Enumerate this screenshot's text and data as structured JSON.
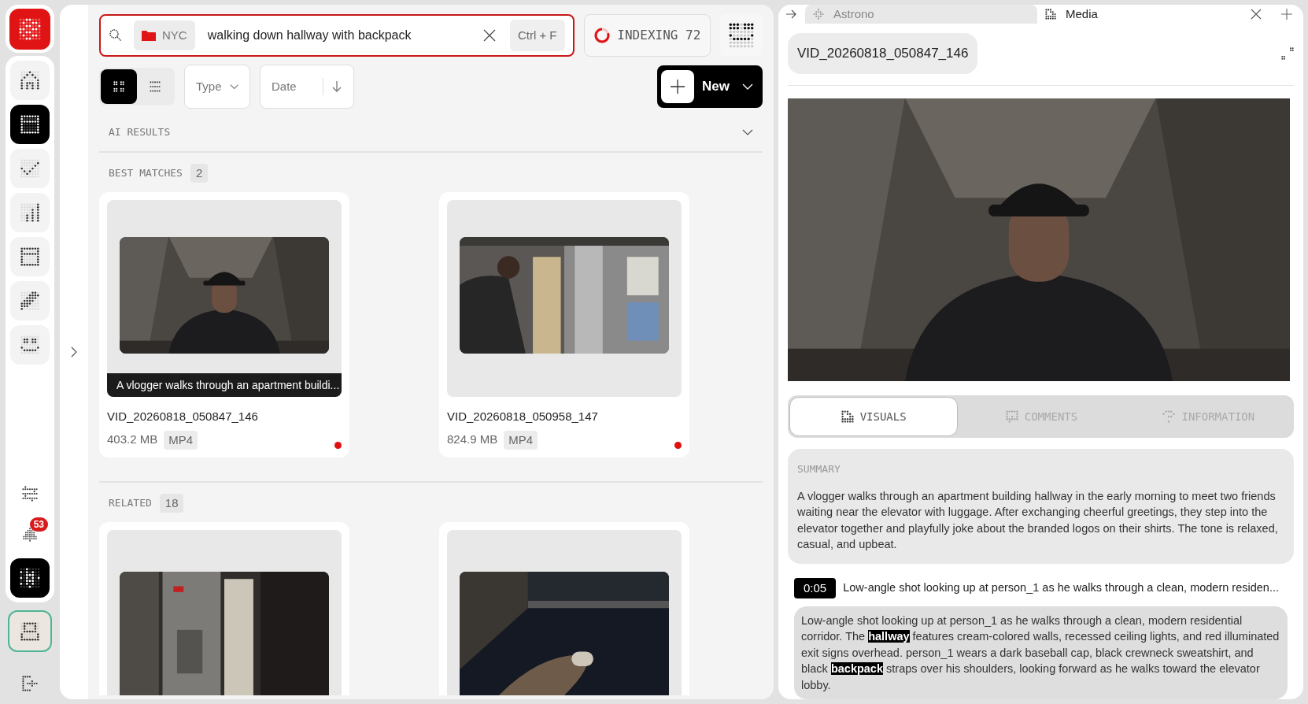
{
  "sidebar": {
    "items": [
      {
        "selected": false
      },
      {
        "selected": true
      },
      {
        "selected": false
      },
      {
        "selected": false
      },
      {
        "selected": false
      },
      {
        "selected": false
      },
      {
        "selected": false
      }
    ],
    "notifications": "53",
    "account": {
      "active": true
    }
  },
  "search": {
    "scope": "NYC",
    "value": "walking down hallway with backpack",
    "shortcut": "Ctrl + F"
  },
  "indexing": {
    "label": "INDEXING 72"
  },
  "view_toggle": [
    {
      "selected": true
    },
    {
      "selected": false
    }
  ],
  "filters": [
    {
      "label": "Type"
    },
    {
      "label": "Date"
    }
  ],
  "new_button": "New",
  "ai_results": {
    "label": "AI RESULTS"
  },
  "best_matches": {
    "label": "BEST MATCHES",
    "count": "2",
    "items": [
      {
        "caption": "A vlogger walks through an apartment buildi...",
        "filename": "VID_20260818_050847_146",
        "size": "403.2 MB",
        "format": "MP4"
      },
      {
        "filename": "VID_20260818_050958_147",
        "size": "824.9 MB",
        "format": "MP4"
      }
    ]
  },
  "related": {
    "label": "RELATED",
    "count": "18"
  },
  "panel_tabs": [
    {
      "label": "Astrono",
      "selected": false
    },
    {
      "label": "Media",
      "selected": true
    }
  ],
  "media_title": "VID_20260818_050847_146",
  "detail_tabs": [
    {
      "label": "VISUALS",
      "selected": true
    },
    {
      "label": "COMMENTS",
      "selected": false
    },
    {
      "label": "INFORMATION",
      "selected": false
    }
  ],
  "summary": {
    "heading": "SUMMARY",
    "text": "A vlogger walks through an apartment building hallway in the early morning to meet two friends waiting near the elevator with luggage. After exchanging cheerful greetings, they step into the elevator together and playfully joke about the branded logos on their shirts. The tone is relaxed, casual, and upbeat."
  },
  "segment": {
    "timestamp": "0:05",
    "title": "Low-angle shot looking up at person_1 as he walks through a clean, modern residen...",
    "description": "Low-angle shot looking up at person_1 as he walks through a clean, modern residential corridor. The **hallway** features cream-colored walls, recessed ceiling lights, and red illuminated exit signs overhead. person_1 wears a dark baseball cap, black crewneck sweatshirt, and black **backpack** straps over his shoulders, looking forward as he walks toward the elevator lobby."
  }
}
